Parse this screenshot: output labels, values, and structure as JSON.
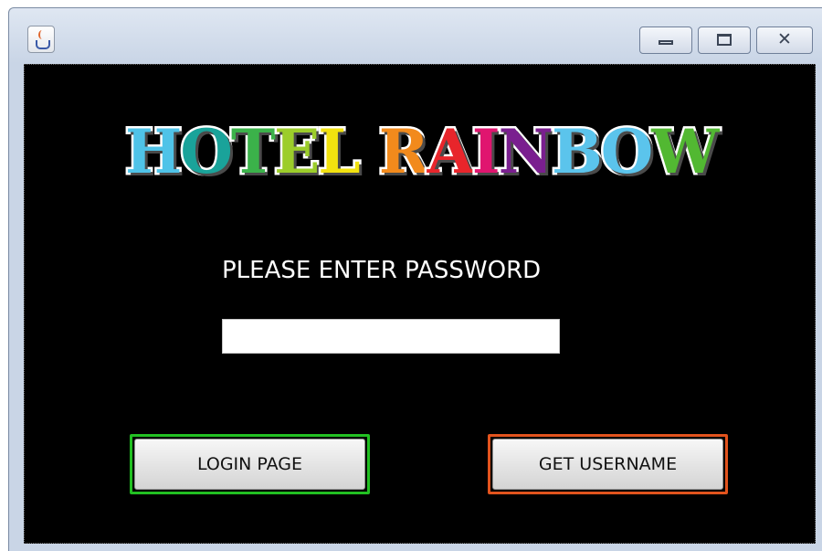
{
  "window": {
    "title": "",
    "controls": {
      "minimize": "minimize",
      "maximize": "maximize",
      "close": "✕"
    }
  },
  "logo": {
    "text": "HOTEL RAINBOW",
    "letters": [
      {
        "char": "H",
        "color": "#4fc3e8"
      },
      {
        "char": "O",
        "color": "#1aa39a"
      },
      {
        "char": "T",
        "color": "#3bb24a"
      },
      {
        "char": "E",
        "color": "#9ccd2a"
      },
      {
        "char": "L",
        "color": "#f2e20f"
      },
      {
        "char": " ",
        "color": ""
      },
      {
        "char": "R",
        "color": "#f28a1c"
      },
      {
        "char": "A",
        "color": "#e8252b"
      },
      {
        "char": "I",
        "color": "#e0156f"
      },
      {
        "char": "N",
        "color": "#7a1f8f"
      },
      {
        "char": "B",
        "color": "#5bc4ec"
      },
      {
        "char": "O",
        "color": "#5bc4ec"
      },
      {
        "char": "W",
        "color": "#52b832"
      }
    ]
  },
  "form": {
    "prompt": "PLEASE ENTER PASSWORD",
    "password_value": "",
    "password_placeholder": ""
  },
  "buttons": {
    "login_label": "LOGIN PAGE",
    "login_border": "#22c022",
    "username_label": "GET USERNAME",
    "username_border": "#e2531d"
  },
  "colors": {
    "background": "#000000",
    "text": "#ffffff"
  },
  "icons": {
    "app": "java-coffee-icon"
  }
}
